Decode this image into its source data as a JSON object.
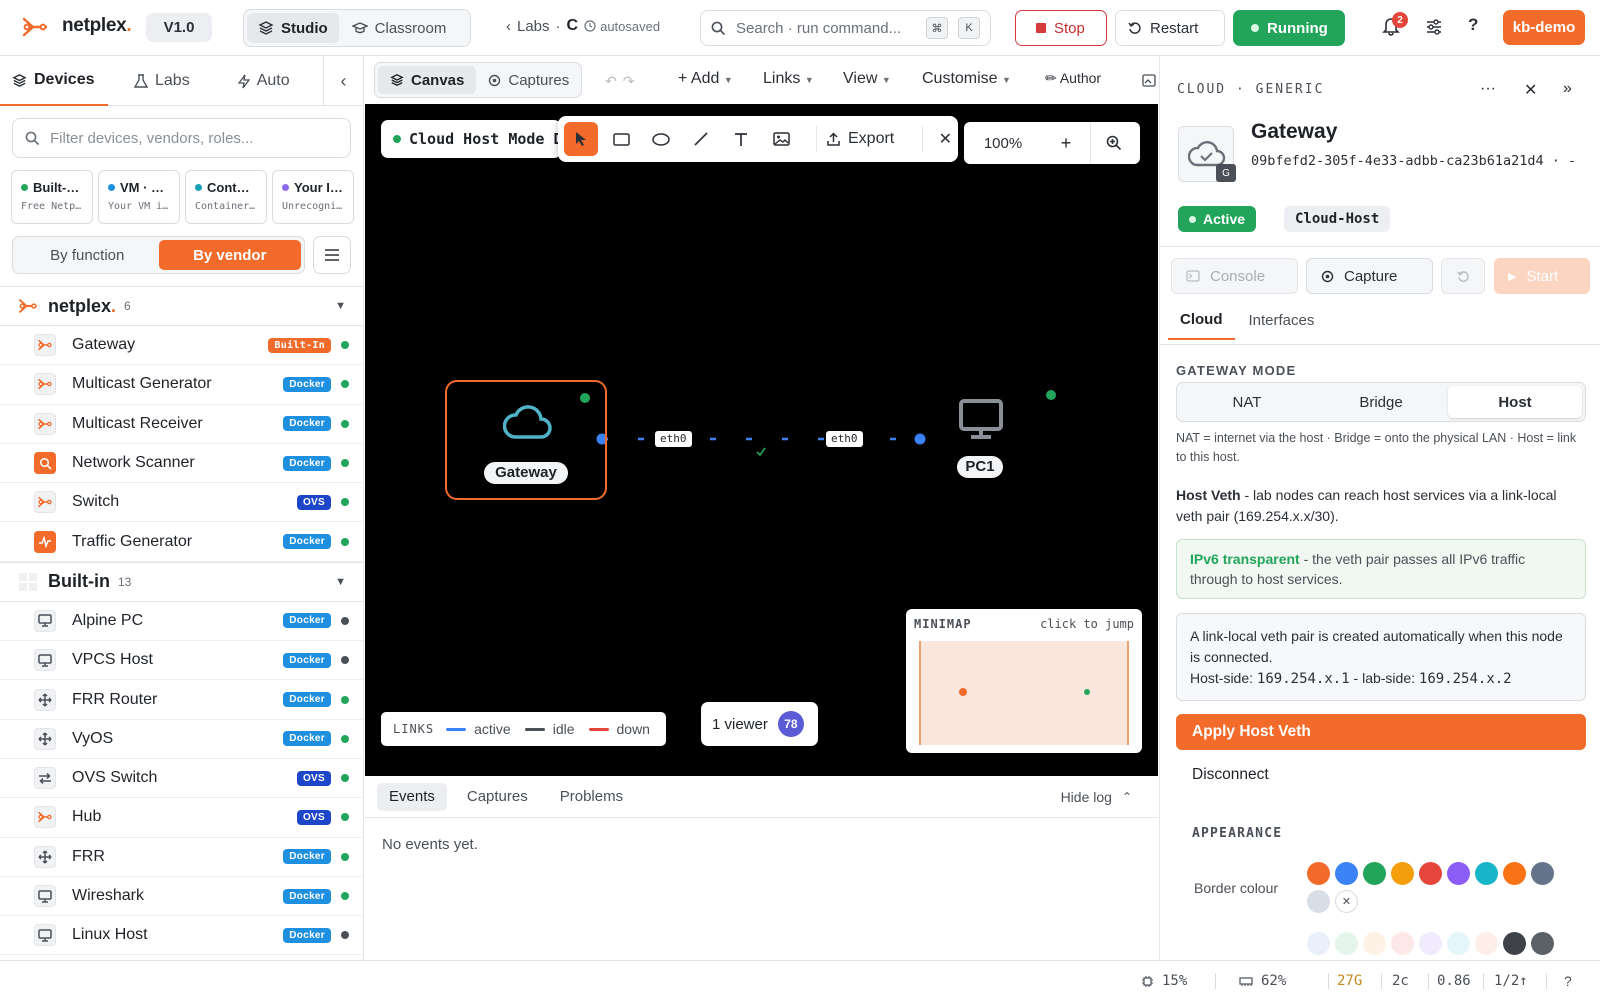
{
  "app": {
    "name": "netplex",
    "version": "V1.0"
  },
  "mode_tabs": [
    {
      "label": "Studio",
      "active": true
    },
    {
      "label": "Classroom",
      "active": false
    }
  ],
  "breadcrumb": {
    "back_label": "Labs",
    "current": "C",
    "status": "autosaved"
  },
  "search": {
    "placeholder": "Search · run command...",
    "shortcut_keys": [
      "⌘",
      "K"
    ]
  },
  "toolbar": {
    "stop_label": "Stop",
    "restart_label": "Restart",
    "running_label": "Running",
    "notifications_count": "2",
    "help_label": "?",
    "user_label": "kb-demo"
  },
  "left_panel": {
    "tabs": [
      {
        "label": "Devices",
        "icon": "layers-icon",
        "active": true
      },
      {
        "label": "Labs",
        "icon": "flask-icon",
        "active": false
      },
      {
        "label": "Auto",
        "icon": "bolt-icon",
        "active": false
      }
    ],
    "filter_placeholder": "Filter devices, vendors, roles...",
    "source_cards": [
      {
        "title": "Built-…",
        "subtitle": "Free Netp…",
        "color": "#22a55b"
      },
      {
        "title": "VM · …",
        "subtitle": "Your VM i…",
        "color": "#1f8fe0"
      },
      {
        "title": "Cont…",
        "subtitle": "Container…",
        "color": "#17a2b8"
      },
      {
        "title": "Your I…",
        "subtitle": "Unrecogni…",
        "color": "#8b6cf0"
      }
    ],
    "grouping": [
      {
        "label": "By function",
        "active": false
      },
      {
        "label": "By vendor",
        "active": true
      }
    ],
    "groups": [
      {
        "name": "netplex",
        "count": "6",
        "items": [
          {
            "name": "Gateway",
            "tag": "Built-In",
            "tag_type": "builtin",
            "icon": "netplex-logo-icon",
            "status": "green"
          },
          {
            "name": "Multicast Generator",
            "tag": "Docker",
            "tag_type": "docker",
            "icon": "netplex-logo-icon",
            "status": "green"
          },
          {
            "name": "Multicast Receiver",
            "tag": "Docker",
            "tag_type": "docker",
            "icon": "netplex-logo-icon",
            "status": "green"
          },
          {
            "name": "Network Scanner",
            "tag": "Docker",
            "tag_type": "docker",
            "icon": "scanner-icon",
            "status": "green"
          },
          {
            "name": "Switch",
            "tag": "OVS",
            "tag_type": "ovs",
            "icon": "netplex-logo-icon",
            "status": "green"
          },
          {
            "name": "Traffic Generator",
            "tag": "Docker",
            "tag_type": "docker",
            "icon": "traffic-icon",
            "status": "green"
          }
        ]
      },
      {
        "name": "Built-in",
        "count": "13",
        "items": [
          {
            "name": "Alpine PC",
            "tag": "Docker",
            "tag_type": "docker",
            "icon": "monitor-icon",
            "status": "gray"
          },
          {
            "name": "VPCS Host",
            "tag": "Docker",
            "tag_type": "docker",
            "icon": "monitor-icon",
            "status": "gray"
          },
          {
            "name": "FRR Router",
            "tag": "Docker",
            "tag_type": "docker",
            "icon": "router-icon",
            "status": "green"
          },
          {
            "name": "VyOS",
            "tag": "Docker",
            "tag_type": "docker",
            "icon": "router-icon",
            "status": "green"
          },
          {
            "name": "OVS Switch",
            "tag": "OVS",
            "tag_type": "ovs",
            "icon": "switch-icon",
            "status": "green"
          },
          {
            "name": "Hub",
            "tag": "OVS",
            "tag_type": "ovs",
            "icon": "netplex-logo-icon",
            "status": "green"
          },
          {
            "name": "FRR",
            "tag": "Docker",
            "tag_type": "docker",
            "icon": "router-icon",
            "status": "green"
          },
          {
            "name": "Wireshark",
            "tag": "Docker",
            "tag_type": "docker",
            "icon": "monitor-icon",
            "status": "green"
          },
          {
            "name": "Linux Host",
            "tag": "Docker",
            "tag_type": "docker",
            "icon": "monitor-icon",
            "status": "gray"
          }
        ]
      }
    ]
  },
  "center": {
    "view_tabs": [
      {
        "label": "Canvas",
        "active": true
      },
      {
        "label": "Captures",
        "active": false
      }
    ],
    "menus": [
      "+ Add",
      "Links",
      "View",
      "Customise"
    ],
    "author_label": "✏ Author",
    "lab_title": "Cloud Host Mode D",
    "export_label": "Export",
    "zoom": "100%",
    "nodes": [
      {
        "label": "Gateway",
        "icon": "cloud-icon"
      },
      {
        "label": "PC1",
        "icon": "monitor-icon"
      }
    ],
    "link": {
      "a_if": "eth0",
      "b_if": "eth0",
      "state": "active"
    },
    "legend": {
      "title": "LINKS",
      "items": [
        {
          "label": "active",
          "color": "#3b82f6"
        },
        {
          "label": "idle",
          "color": "#4b5058"
        },
        {
          "label": "down",
          "color": "#e5463c"
        }
      ]
    },
    "viewers": {
      "label": "1 viewer",
      "count": "78"
    },
    "minimap": {
      "title": "MINIMAP",
      "hint": "click to jump"
    },
    "log_tabs": [
      {
        "label": "Events",
        "active": true
      },
      {
        "label": "Captures",
        "active": false
      },
      {
        "label": "Problems",
        "active": false
      }
    ],
    "hide_log_label": "Hide log",
    "empty_events": "No events yet."
  },
  "right_panel": {
    "header": "CLOUD · GENERIC",
    "title": "Gateway",
    "uuid": "09bfefd2-305f-4e33-adbb-ca23b61a21d4 · -",
    "icon_badge": "G",
    "status_label": "Active",
    "kind_label": "Cloud-Host",
    "actions": {
      "console": "Console",
      "capture": "Capture",
      "start": "Start"
    },
    "tabs": [
      {
        "label": "Cloud",
        "active": true
      },
      {
        "label": "Interfaces",
        "active": false
      }
    ],
    "gateway_mode_label": "GATEWAY MODE",
    "gateway_modes": [
      {
        "label": "NAT",
        "active": false
      },
      {
        "label": "Bridge",
        "active": false
      },
      {
        "label": "Host",
        "active": true
      }
    ],
    "mode_hint": "NAT = internet via the host · Bridge = onto the physical LAN · Host = link to this host.",
    "host_veth_title": "Host Veth",
    "host_veth_desc": " - lab nodes can reach host services via a link-local veth pair (169.254.x.x/30).",
    "ipv6_title": "IPv6 transparent",
    "ipv6_desc": " - the veth pair passes all IPv6 traffic through to host services.",
    "info_line1": "A link-local veth pair is created automatically when this node is connected.",
    "info_host_label": "Host-side: ",
    "info_host_value": "169.254.x.1",
    "info_lab_label": " - lab-side: ",
    "info_lab_value": "169.254.x.2",
    "apply_label": "Apply Host Veth",
    "disconnect_label": "Disconnect",
    "appearance_label": "APPEARANCE",
    "border_colour_label": "Border colour",
    "swatches": [
      "#f26b2b",
      "#3b82f6",
      "#22a55b",
      "#f59e0b",
      "#e5463c",
      "#8b5cf6",
      "#17b5c8",
      "#f97316",
      "#64748b",
      "#d8dde6"
    ]
  },
  "status_bar": {
    "cpu": "15%",
    "memory": "62%",
    "disk": "27G",
    "cores": "2c",
    "load": "0.86",
    "ratio": "1/2↑",
    "help": "?"
  }
}
